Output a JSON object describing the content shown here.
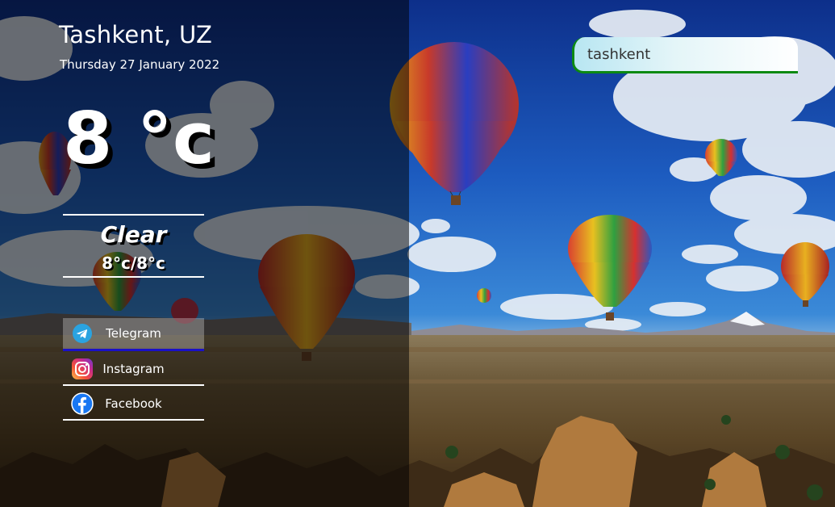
{
  "location": {
    "city": "Tashkent, UZ",
    "date": "Thursday 27 January 2022"
  },
  "weather": {
    "temperature": "8 °c",
    "condition": "Clear",
    "min_max": "8°c/8°c"
  },
  "search": {
    "value": "tashkent"
  },
  "social": [
    {
      "label": "Telegram",
      "icon": "telegram-icon",
      "active": true
    },
    {
      "label": "Instagram",
      "icon": "instagram-icon",
      "active": false
    },
    {
      "label": "Facebook",
      "icon": "facebook-icon",
      "active": false
    }
  ],
  "colors": {
    "search_border": "#0c8a12",
    "active_underline": "#1a10c8",
    "telegram": "#2aa3e0",
    "facebook": "#1877f2"
  }
}
